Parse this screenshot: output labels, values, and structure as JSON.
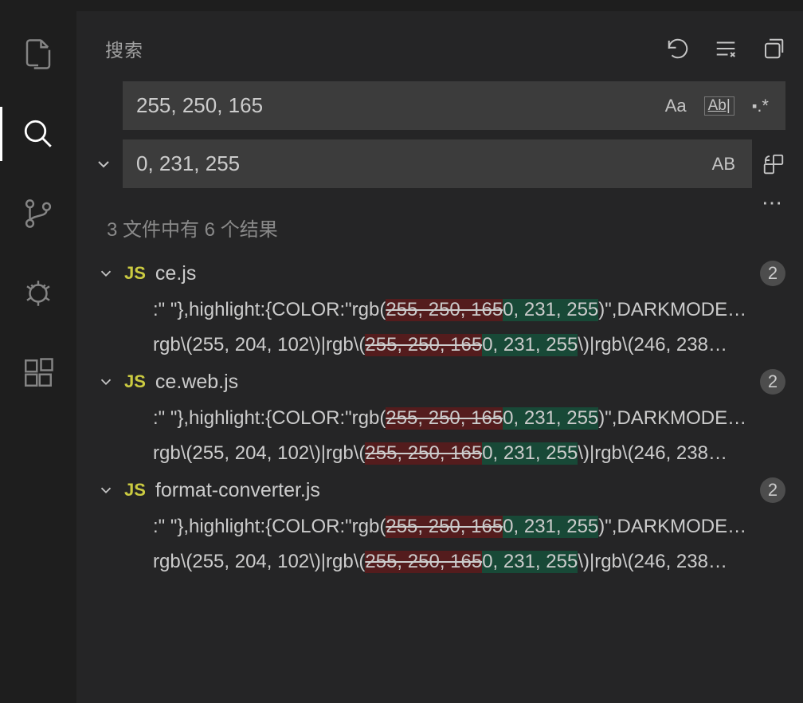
{
  "search": {
    "title": "搜索",
    "search_value": "255, 250, 165",
    "replace_value": "0, 231, 255",
    "match_case_label": "Aa",
    "whole_word_label": "Ab|",
    "regex_label": ".*",
    "preserve_case_label": "AB",
    "summary": "3 文件中有 6 个结果"
  },
  "results": [
    {
      "filename": "ce.js",
      "badge": "JS",
      "count": "2",
      "matches": [
        {
          "pre": ":\" \"},highlight:{COLOR:\"rgb(",
          "remove": "255, 250, 165",
          "add": "0, 231, 255",
          "post": ")\",DARKMODE…"
        },
        {
          "pre": "rgb\\(255, 204, 102\\)|rgb\\(",
          "remove": "255, 250, 165",
          "add": "0, 231, 255",
          "post": "\\)|rgb\\(246, 238…"
        }
      ]
    },
    {
      "filename": "ce.web.js",
      "badge": "JS",
      "count": "2",
      "matches": [
        {
          "pre": ":\" \"},highlight:{COLOR:\"rgb(",
          "remove": "255, 250, 165",
          "add": "0, 231, 255",
          "post": ")\",DARKMODE…"
        },
        {
          "pre": "rgb\\(255, 204, 102\\)|rgb\\(",
          "remove": "255, 250, 165",
          "add": "0, 231, 255",
          "post": "\\)|rgb\\(246, 238…"
        }
      ]
    },
    {
      "filename": "format-converter.js",
      "badge": "JS",
      "count": "2",
      "matches": [
        {
          "pre": ":\" \"},highlight:{COLOR:\"rgb(",
          "remove": "255, 250, 165",
          "add": "0, 231, 255",
          "post": ")\",DARKMODE…"
        },
        {
          "pre": "rgb\\(255, 204, 102\\)|rgb\\(",
          "remove": "255, 250, 165",
          "add": "0, 231, 255",
          "post": "\\)|rgb\\(246, 238…"
        }
      ]
    }
  ]
}
